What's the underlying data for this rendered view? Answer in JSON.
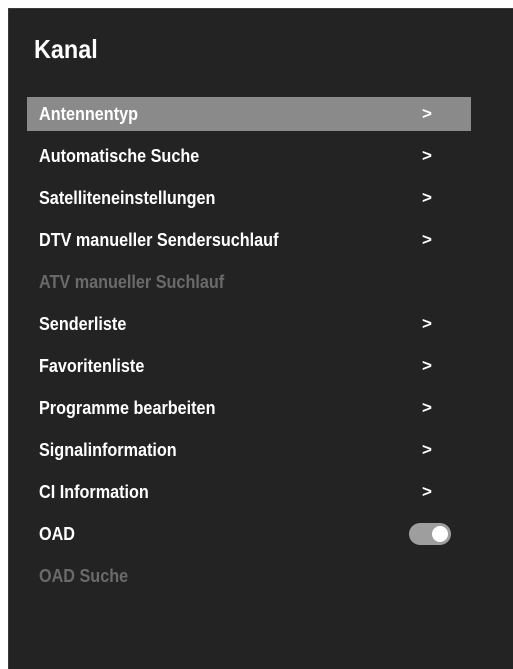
{
  "title": "Kanal",
  "menu": {
    "items": [
      {
        "label": "Antennentyp",
        "indicator": ">"
      },
      {
        "label": "Automatische Suche",
        "indicator": ">"
      },
      {
        "label": "Satelliteneinstellungen",
        "indicator": ">"
      },
      {
        "label": "DTV manueller Sendersuchlauf",
        "indicator": ">"
      },
      {
        "label": "ATV manueller Suchlauf",
        "state": "disabled"
      },
      {
        "label": "Senderliste",
        "indicator": ">"
      },
      {
        "label": "Favoritenliste",
        "indicator": ">"
      },
      {
        "label": "Programme bearbeiten",
        "indicator": ">"
      },
      {
        "label": "Signalinformation",
        "indicator": ">"
      },
      {
        "label": "CI Information",
        "indicator": ">"
      },
      {
        "label": "OAD",
        "toggle": "on"
      },
      {
        "label": "OAD Suche",
        "state": "disabled"
      }
    ],
    "selected_index": 0
  },
  "colors": {
    "panel_background": "#232323",
    "selected_background": "#8a8a8a",
    "text": "#ffffff",
    "disabled_text": "#6a6a6a",
    "toggle_track": "#9e9e9e",
    "toggle_knob": "#ffffff"
  }
}
